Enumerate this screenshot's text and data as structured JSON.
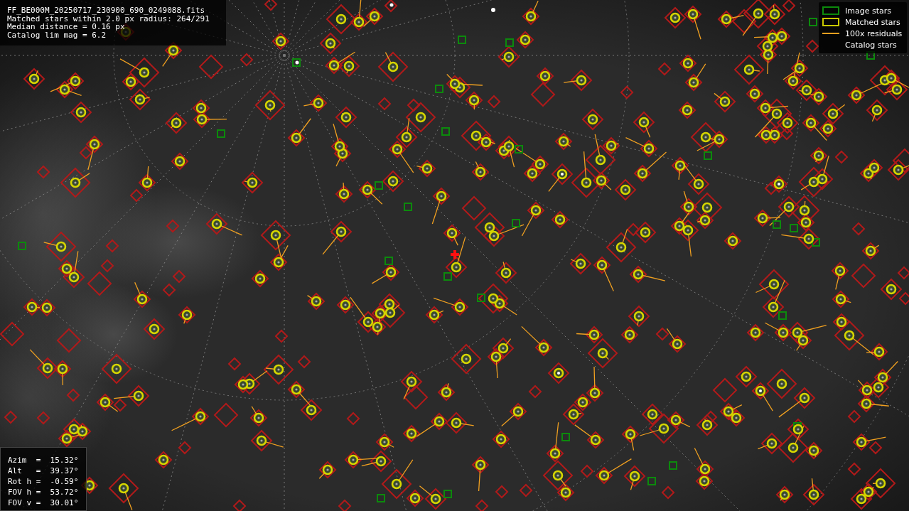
{
  "file_info": {
    "lines": [
      "FF_BE000M_20250717_230900_690_0249088.fits",
      "Matched stars within 2.0 px radius: 264/291",
      "Median distance = 0.16 px",
      "Catalog lim mag = 6.2"
    ]
  },
  "legend": {
    "items": [
      {
        "label": "Image stars",
        "kind": "image"
      },
      {
        "label": "Matched stars",
        "kind": "matched"
      },
      {
        "label": "100x residuals",
        "kind": "residual"
      },
      {
        "label": "Catalog stars",
        "kind": "catalog"
      }
    ]
  },
  "pointing": {
    "rows": [
      "Azim  =  15.32°",
      "Alt   =  39.37°",
      "Rot h =  -0.59°",
      "FOV h =  53.72°",
      "FOV v =  30.01°"
    ]
  }
}
